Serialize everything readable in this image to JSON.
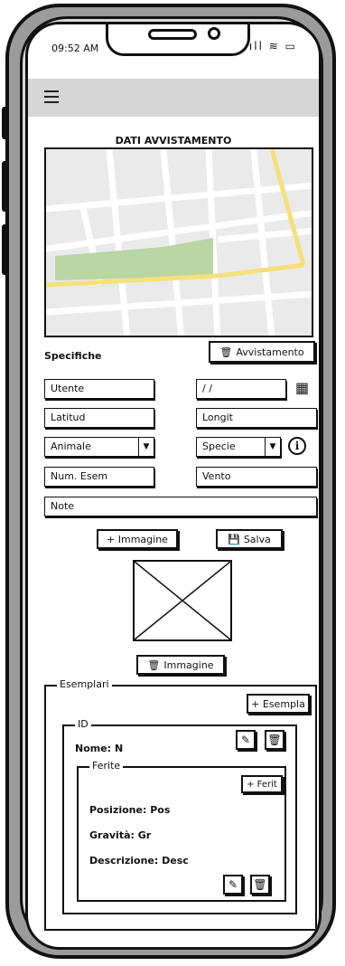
{
  "status": {
    "time": "09:52 AM",
    "signal_icon": "signal-icon",
    "wifi_icon": "wifi-icon",
    "battery_icon": "battery-icon"
  },
  "header": {
    "menu_icon": "hamburger-icon",
    "title": "DATI AVVISTAMENTO"
  },
  "specifiche": {
    "label": "Specifiche",
    "delete_button": "Avvistamento",
    "utente": "Utente",
    "date": "/ /",
    "latitud": "Latitud",
    "longit": "Longit",
    "animale": "Animale",
    "specie": "Specie",
    "num_esem": "Num. Esem",
    "vento": "Vento",
    "note": "Note"
  },
  "actions": {
    "add_image": "+ Immagine",
    "save": "Salva",
    "delete_image": "Immagine"
  },
  "esemplari": {
    "legend": "Esemplari",
    "add_button": "+ Esempla",
    "item": {
      "legend": "ID",
      "nome_label": "Nome:",
      "nome_value": "N",
      "ferite": {
        "legend": "Ferite",
        "add_button": "+ Ferit",
        "posizione_label": "Posizione:",
        "posizione_value": "Pos",
        "gravita_label": "Gravità:",
        "gravita_value": "Gr",
        "descrizione_label": "Descrizione:",
        "descrizione_value": "Desc"
      }
    }
  },
  "colors": {
    "map_bg": "#efefef",
    "map_road_major": "#f5e07a",
    "map_park": "#b9d6a4",
    "topbar": "#d6d6d6"
  }
}
